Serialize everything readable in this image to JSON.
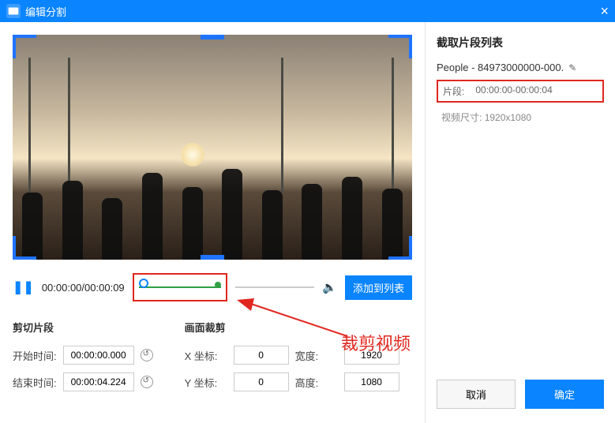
{
  "header": {
    "title": "编辑分割"
  },
  "playback": {
    "current": "00:00:00",
    "total": "00:00:09",
    "addToList": "添加到列表"
  },
  "clip": {
    "title": "剪切片段",
    "startLabel": "开始时间:",
    "startValue": "00:00:00.000",
    "endLabel": "结束时间:",
    "endValue": "00:00:04.224"
  },
  "crop": {
    "title": "画面裁剪",
    "xLabel": "X 坐标:",
    "xValue": "0",
    "yLabel": "Y 坐标:",
    "yValue": "0",
    "wLabel": "宽度:",
    "wValue": "1920",
    "hLabel": "高度:",
    "hValue": "1080"
  },
  "segments": {
    "title": "截取片段列表",
    "fileName": "People - 84973000000-000.",
    "segLabel": "片段:",
    "segRange": "00:00:00-00:00:04",
    "dimLabel": "视频尺寸:",
    "dimValue": "1920x1080"
  },
  "buttons": {
    "cancel": "取消",
    "ok": "确定"
  },
  "annotation": {
    "text": "裁剪视频"
  }
}
